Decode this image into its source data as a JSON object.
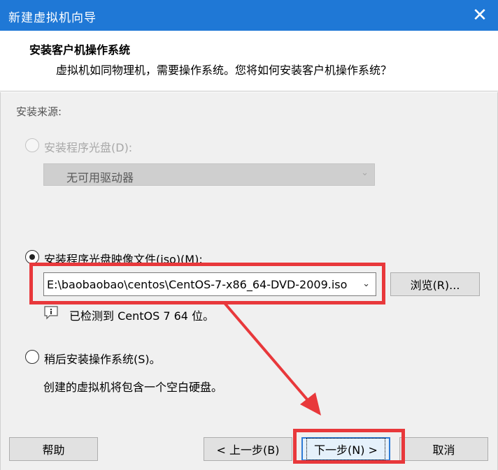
{
  "window": {
    "title": "新建虚拟机向导",
    "close_glyph": "✕"
  },
  "header": {
    "title": "安装客户机操作系统",
    "subtitle": "虚拟机如同物理机，需要操作系统。您将如何安装客户机操作系统？"
  },
  "install_source": {
    "label": "安装来源:",
    "disc": {
      "label": "安装程序光盘(D):",
      "selected": false,
      "enabled": false,
      "drive_value": "无可用驱动器"
    },
    "iso": {
      "label": "安装程序光盘映像文件(iso)(M):",
      "selected": true,
      "value": "E:\\baobaobao\\centos\\CentOS-7-x86_64-DVD-2009.iso",
      "browse_label": "浏览(R)...",
      "detected_text": "已检测到 CentOS 7 64 位。"
    },
    "later": {
      "label": "稍后安装操作系统(S)。",
      "selected": false,
      "note": "创建的虚拟机将包含一个空白硬盘。"
    }
  },
  "footer": {
    "help_label": "帮助",
    "back_label": "< 上一步(B)",
    "next_label": "下一步(N) >",
    "cancel_label": "取消"
  },
  "annotations": {
    "highlight_color": "#e8383b"
  }
}
